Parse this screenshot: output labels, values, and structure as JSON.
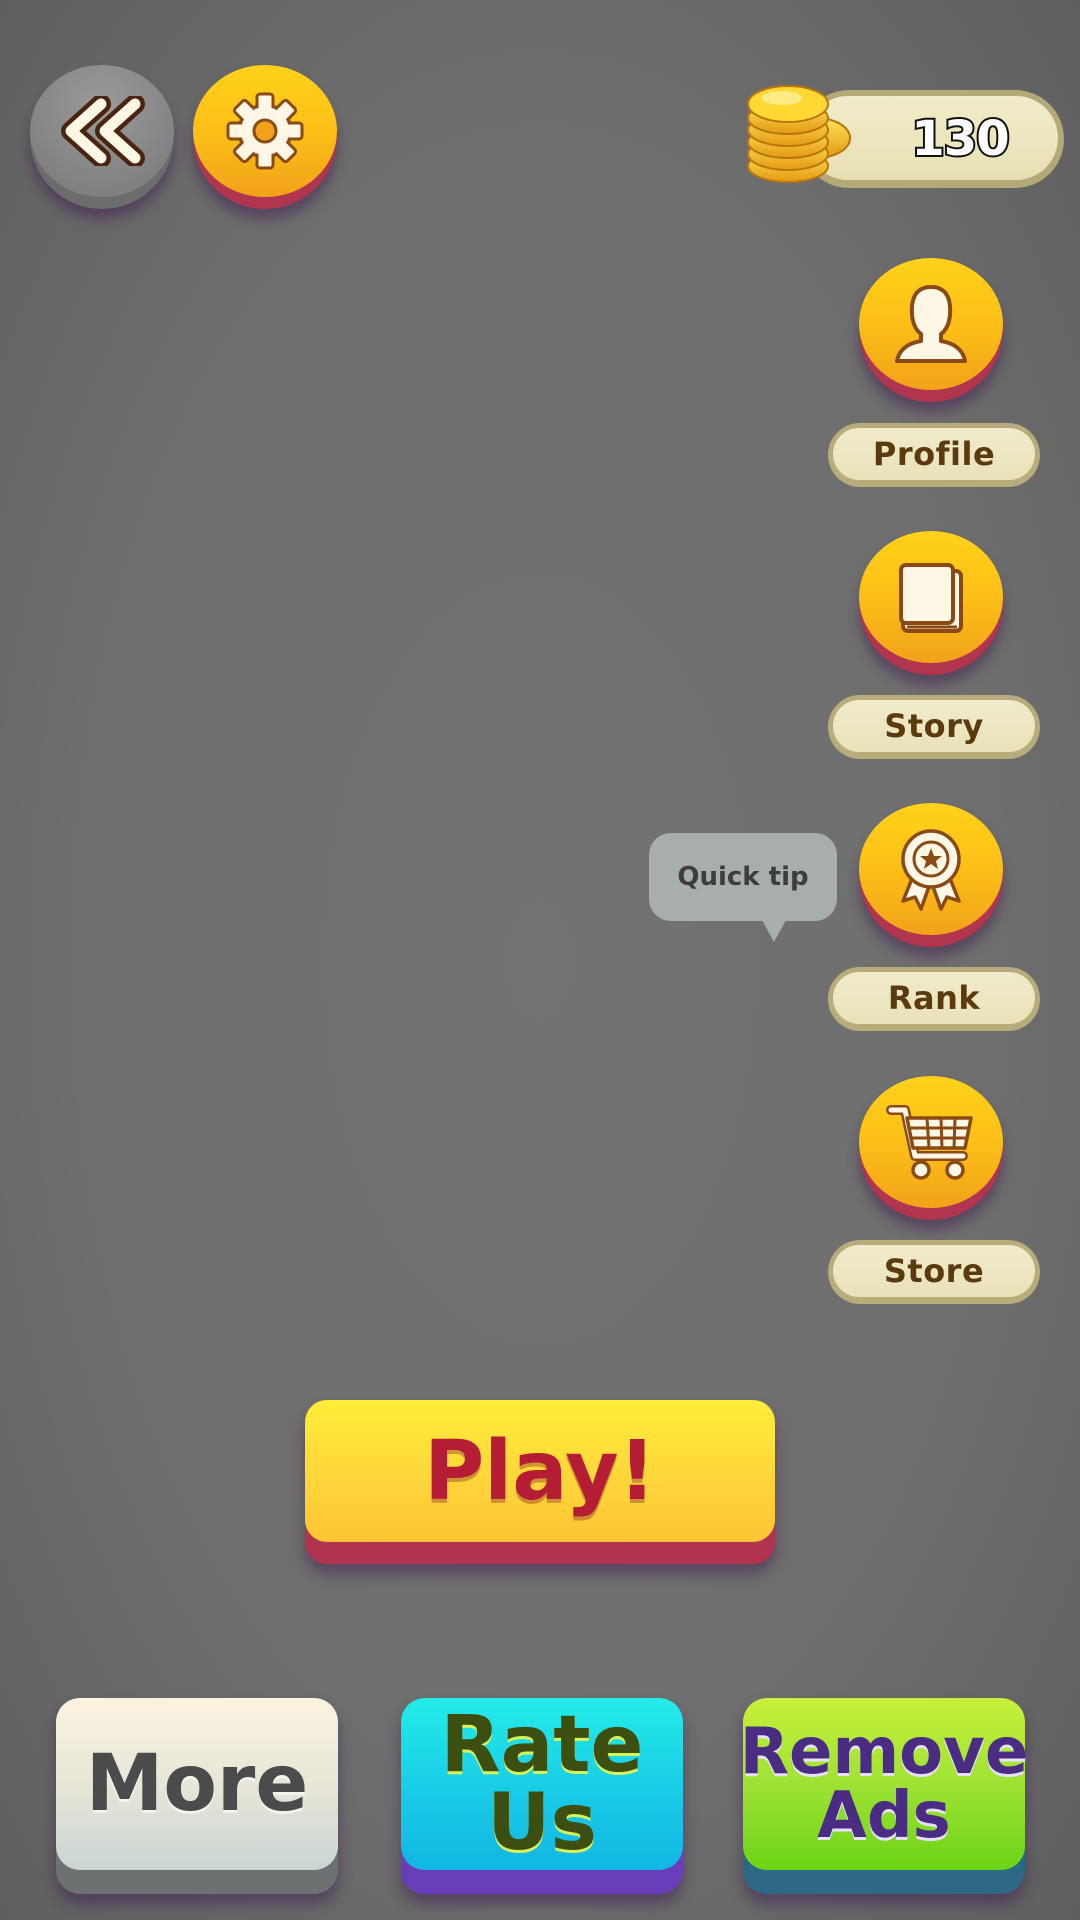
{
  "header": {
    "back_icon": "double-chevron-left-icon",
    "settings_icon": "gear-icon",
    "coins": {
      "value": "130",
      "icon": "coin-stack-icon"
    }
  },
  "side_menu": [
    {
      "label": "Profile",
      "icon": "person-icon"
    },
    {
      "label": "Story",
      "icon": "book-icon"
    },
    {
      "label": "Rank",
      "icon": "award-ribbon-icon"
    },
    {
      "label": "Store",
      "icon": "shopping-cart-icon"
    }
  ],
  "tooltip": {
    "text": "Quick tip"
  },
  "play_button": {
    "label": "Play!"
  },
  "bottom_buttons": {
    "more": "More",
    "rate": "Rate Us",
    "remove_ads_line1": "Remove",
    "remove_ads_line2": "Ads"
  },
  "colors": {
    "gold": "#fbbd17",
    "gold_base": "#b1354f",
    "pill": "#e9e2b8",
    "pill_text": "#5a3a0e",
    "play_text": "#b51d34",
    "rate": "#19cbe6",
    "ads": "#9ee233",
    "background": "#707070"
  }
}
